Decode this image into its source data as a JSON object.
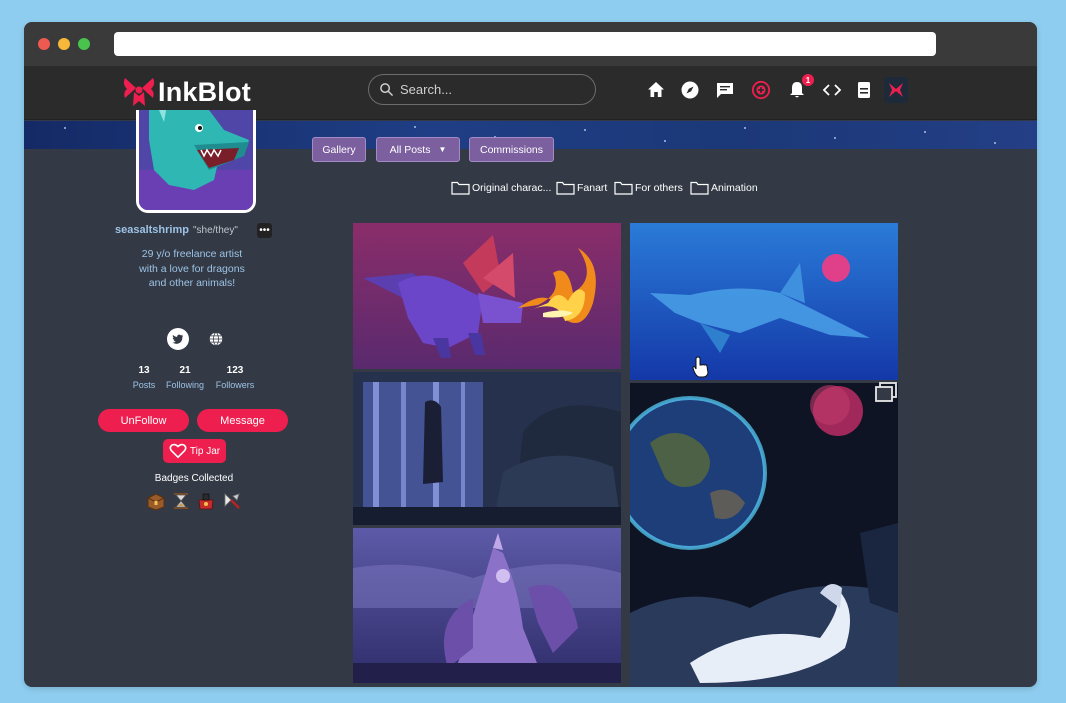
{
  "app": {
    "name": "InkBlot",
    "brand_color": "#ee1f4f",
    "background_color": "#333a45",
    "navbar_color": "#2b2b2b"
  },
  "navbar": {
    "search_placeholder": "Search...",
    "icons": [
      "home-icon",
      "explore-icon",
      "messages-icon",
      "create-post-icon",
      "notifications-icon",
      "code-icon",
      "storage-icon",
      "user-avatar-icon"
    ],
    "notification_count": "1"
  },
  "profile": {
    "username": "seasaltshrimp",
    "pronouns": "\"she/they\"",
    "more_label": "•••",
    "bio": "29 y/o freelance artist with a love for dragons and other animals!",
    "social_links": [
      "twitter-icon",
      "globe-icon"
    ],
    "stats": [
      {
        "value": "13",
        "label": "Posts"
      },
      {
        "value": "21",
        "label": "Following"
      },
      {
        "value": "123",
        "label": "Followers"
      }
    ],
    "unfollow_label": "UnFollow",
    "message_label": "Message",
    "tipjar_label": "Tip Jar",
    "badges_title": "Badges Collected",
    "badges": [
      "treasure-chest-icon",
      "hourglass-icon",
      "bag-icon",
      "compass-icon"
    ]
  },
  "tabs": [
    {
      "label": "Gallery",
      "active": true
    },
    {
      "label": "All Posts",
      "has_dropdown": true
    },
    {
      "label": "Commissions"
    }
  ],
  "folders": [
    {
      "label": "Original charac..."
    },
    {
      "label": "Fanart"
    },
    {
      "label": "For others"
    },
    {
      "label": "Animation"
    }
  ],
  "gallery": {
    "items": [
      {
        "subject": "purple-dragon-breathing-fire"
      },
      {
        "subject": "whale-underwater"
      },
      {
        "subject": "figure-behind-waterfall"
      },
      {
        "subject": "earth-from-space-with-dragon",
        "multi_image": true
      },
      {
        "subject": "purple-bat-dragon"
      }
    ]
  }
}
